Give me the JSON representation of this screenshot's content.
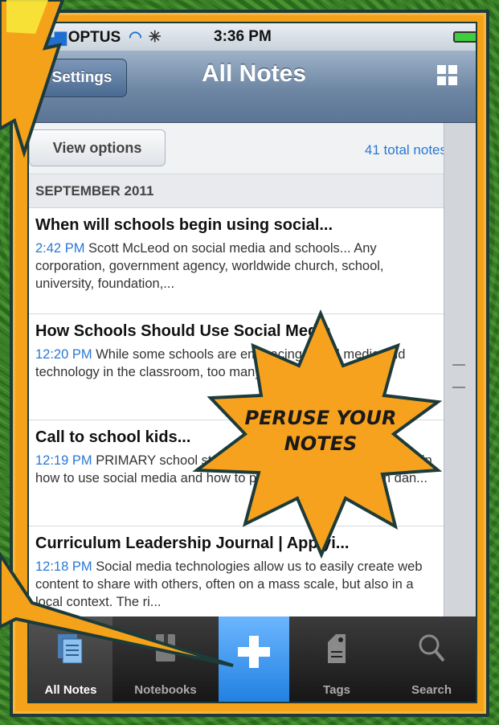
{
  "status": {
    "carrier": "OPTUS",
    "time": "3:36 PM"
  },
  "nav": {
    "settings_label": "Settings",
    "title": "All Notes"
  },
  "toolbar": {
    "view_options_label": "View options",
    "total_notes": "41 total notes"
  },
  "section_header": "SEPTEMBER 2011",
  "notes": [
    {
      "title": "When will schools begin using social...",
      "time": "2:42 PM",
      "snippet": "Scott McLeod on social media and schools... Any corporation, government agency, worldwide church, school, university, foundation,..."
    },
    {
      "title": "How Schools Should Use Social Media",
      "time": "12:20 PM",
      "snippet": "While some schools are embracing social media and technology in the classroom, too many others are taking..."
    },
    {
      "title": "Call to school kids...",
      "time": "12:19 PM",
      "snippet": "PRIMARY school students should be receiving lessons in how to use social media and how to protect themselves from dan..."
    },
    {
      "title": "Curriculum Leadership Journal | Applyi...",
      "time": "12:18 PM",
      "snippet": "Social media technologies allow us to easily create web content to share with others, often on a mass scale, but also in a local context. The ri..."
    }
  ],
  "tabs": [
    {
      "label": "All Notes",
      "icon": "notes-icon",
      "active": true
    },
    {
      "label": "Notebooks",
      "icon": "notebook-icon",
      "active": false
    },
    {
      "label": "",
      "icon": "plus-icon",
      "active": false
    },
    {
      "label": "Tags",
      "icon": "tag-icon",
      "active": false
    },
    {
      "label": "Search",
      "icon": "search-icon",
      "active": false
    }
  ],
  "callout": {
    "text_line1": "PERUSE YOUR",
    "text_line2": "NOTES"
  },
  "colors": {
    "accent": "#2a78d4",
    "frame": "#f5a21b",
    "starburst": "#f7a21e",
    "background": "#2f6f20"
  }
}
